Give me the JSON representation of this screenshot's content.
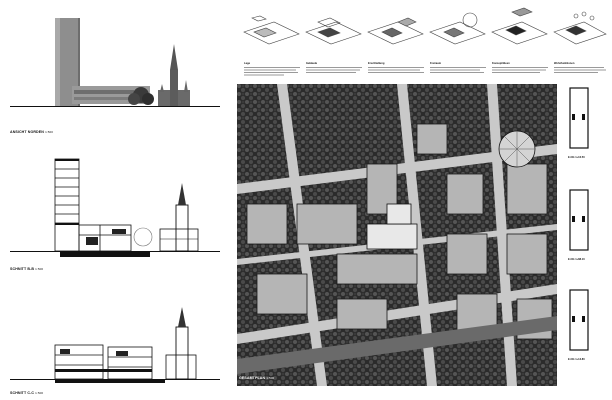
{
  "sections": {
    "north_view": {
      "label": "ANSICHT NORDEN",
      "scale": "1:500"
    },
    "section_b": {
      "label": "SCHNITT B-B",
      "scale": "1:500"
    },
    "section_c": {
      "label": "SCHNITT C-C",
      "scale": "1:500"
    }
  },
  "phases": [
    {
      "title": "Lage"
    },
    {
      "title": "Gebäude"
    },
    {
      "title": "Erschließung"
    },
    {
      "title": "Freiraum"
    },
    {
      "title": "Konzept/Ideen"
    },
    {
      "title": "Wohnfunktionen"
    }
  ],
  "site_plan": {
    "label": "GESAMTPLAN",
    "scale": "1:500"
  },
  "floor_plans": {
    "level_1": "E.OG 1+16.50",
    "level_2": "E.OG 1+88.10",
    "level_3": "E.OG 1+13.80"
  }
}
